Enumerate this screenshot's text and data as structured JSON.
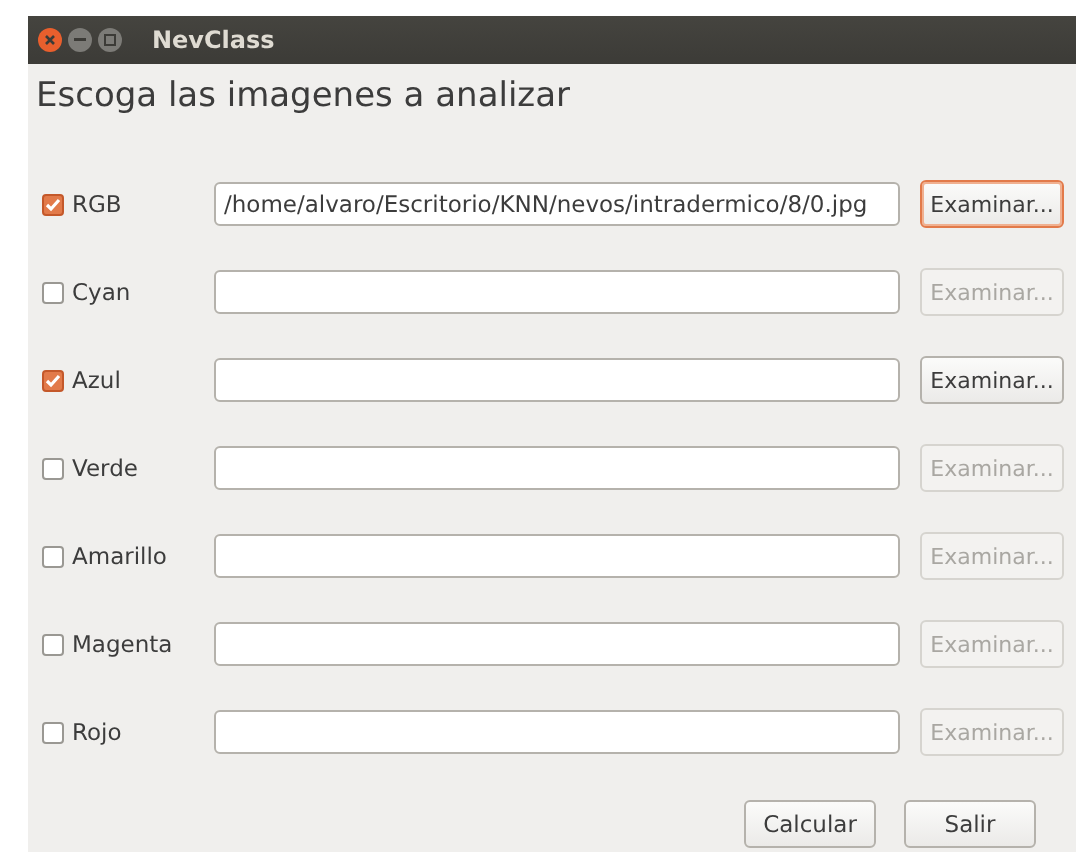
{
  "window": {
    "title": "NevClass"
  },
  "heading": "Escoga las imagenes a analizar",
  "rows": [
    {
      "label": "RGB",
      "checked": true,
      "value": "/home/alvaro/Escritorio/KNN/nevos/intradermico/8/0.jpg",
      "button": {
        "label": "Examinar...",
        "disabled": false,
        "focused": true
      }
    },
    {
      "label": "Cyan",
      "checked": false,
      "button": {
        "label": "Examinar...",
        "disabled": true,
        "focused": false
      }
    },
    {
      "label": "Azul",
      "checked": true,
      "button": {
        "label": "Examinar...",
        "disabled": false,
        "focused": false
      }
    },
    {
      "label": "Verde",
      "checked": false,
      "button": {
        "label": "Examinar...",
        "disabled": true,
        "focused": false
      }
    },
    {
      "label": "Amarillo",
      "checked": false,
      "button": {
        "label": "Examinar...",
        "disabled": true,
        "focused": false
      }
    },
    {
      "label": "Magenta",
      "checked": false,
      "button": {
        "label": "Examinar...",
        "disabled": true,
        "focused": false
      }
    },
    {
      "label": "Rojo",
      "checked": false,
      "button": {
        "label": "Examinar...",
        "disabled": true,
        "focused": false
      }
    }
  ],
  "buttons": [
    "Calcular",
    "Salir"
  ]
}
